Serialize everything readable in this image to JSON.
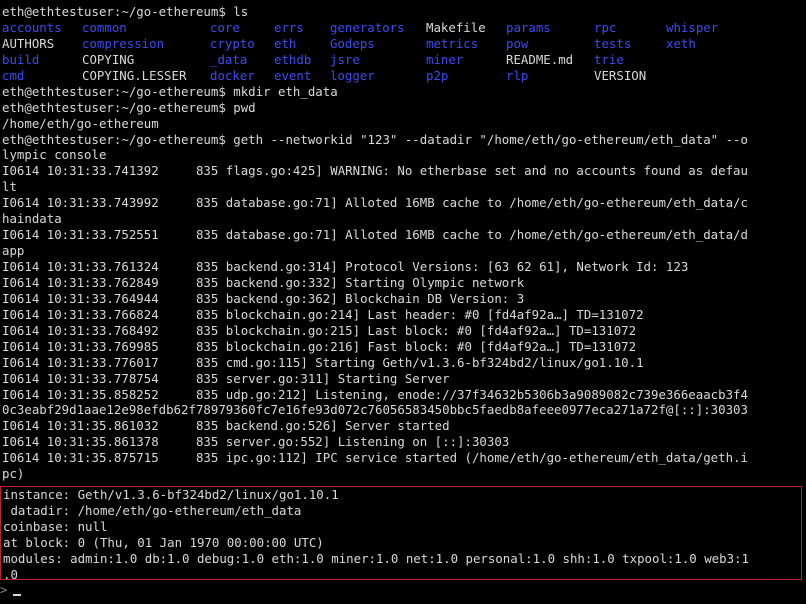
{
  "terminal": {
    "ls_command": "eth@ethtestuser:~/go-ethereum$ ls",
    "ls_rows": [
      [
        {
          "t": "accounts",
          "k": "dir"
        },
        {
          "t": "common",
          "k": "dir"
        },
        {
          "t": "core",
          "k": "dir"
        },
        {
          "t": "errs",
          "k": "dir"
        },
        {
          "t": "generators",
          "k": "dir"
        },
        {
          "t": "Makefile",
          "k": "file"
        },
        {
          "t": "params",
          "k": "dir"
        },
        {
          "t": "rpc",
          "k": "dir"
        },
        {
          "t": "whisper",
          "k": "dir"
        }
      ],
      [
        {
          "t": "AUTHORS",
          "k": "file"
        },
        {
          "t": "compression",
          "k": "dir"
        },
        {
          "t": "crypto",
          "k": "dir"
        },
        {
          "t": "eth",
          "k": "dir"
        },
        {
          "t": "Godeps",
          "k": "dir"
        },
        {
          "t": "metrics",
          "k": "dir"
        },
        {
          "t": "pow",
          "k": "dir"
        },
        {
          "t": "tests",
          "k": "dir"
        },
        {
          "t": "xeth",
          "k": "dir"
        }
      ],
      [
        {
          "t": "build",
          "k": "dir"
        },
        {
          "t": "COPYING",
          "k": "file"
        },
        {
          "t": "_data",
          "k": "dir"
        },
        {
          "t": "ethdb",
          "k": "dir"
        },
        {
          "t": "jsre",
          "k": "dir"
        },
        {
          "t": "miner",
          "k": "dir"
        },
        {
          "t": "README.md",
          "k": "file"
        },
        {
          "t": "trie",
          "k": "dir"
        },
        {
          "t": "",
          "k": "file"
        }
      ],
      [
        {
          "t": "cmd",
          "k": "dir"
        },
        {
          "t": "COPYING.LESSER",
          "k": "file"
        },
        {
          "t": "docker",
          "k": "dir"
        },
        {
          "t": "event",
          "k": "dir"
        },
        {
          "t": "logger",
          "k": "dir"
        },
        {
          "t": "p2p",
          "k": "dir"
        },
        {
          "t": "rlp",
          "k": "dir"
        },
        {
          "t": "VERSION",
          "k": "file"
        },
        {
          "t": "",
          "k": "file"
        }
      ]
    ],
    "lines": [
      "eth@ethtestuser:~/go-ethereum$ mkdir eth_data",
      "eth@ethtestuser:~/go-ethereum$ pwd",
      "/home/eth/go-ethereum",
      "eth@ethtestuser:~/go-ethereum$ geth --networkid \"123\" --datadir \"/home/eth/go-ethereum/eth_data\" --o",
      "lympic console",
      "I0614 10:31:33.741392     835 flags.go:425] WARNING: No etherbase set and no accounts found as defau",
      "lt",
      "I0614 10:31:33.743992     835 database.go:71] Alloted 16MB cache to /home/eth/go-ethereum/eth_data/c",
      "haindata",
      "I0614 10:31:33.752551     835 database.go:71] Alloted 16MB cache to /home/eth/go-ethereum/eth_data/d",
      "app",
      "I0614 10:31:33.761324     835 backend.go:314] Protocol Versions: [63 62 61], Network Id: 123",
      "I0614 10:31:33.762849     835 backend.go:332] Starting Olympic network",
      "I0614 10:31:33.764944     835 backend.go:362] Blockchain DB Version: 3",
      "I0614 10:31:33.766824     835 blockchain.go:214] Last header: #0 [fd4af92a…] TD=131072",
      "I0614 10:31:33.768492     835 blockchain.go:215] Last block: #0 [fd4af92a…] TD=131072",
      "I0614 10:31:33.769985     835 blockchain.go:216] Fast block: #0 [fd4af92a…] TD=131072",
      "I0614 10:31:33.776017     835 cmd.go:115] Starting Geth/v1.3.6-bf324bd2/linux/go1.10.1",
      "I0614 10:31:33.778754     835 server.go:311] Starting Server",
      "I0614 10:31:35.858252     835 udp.go:212] Listening, enode://37f34632b5306b3a9089082c739e366eaacb3f4",
      "0c3eabf29d1aae12e98efdb62f78979360fc7e16fe93d072c76056583450bbc5faedb8afeee0977eca271a72f@[::]:30303",
      "I0614 10:31:35.861032     835 backend.go:526] Server started",
      "I0614 10:31:35.861378     835 server.go:552] Listening on [::]:30303",
      "I0614 10:31:35.875715     835 ipc.go:112] IPC service started (/home/eth/go-ethereum/eth_data/geth.i",
      "pc)"
    ],
    "console_lines": [
      "instance: Geth/v1.3.6-bf324bd2/linux/go1.10.1",
      " datadir: /home/eth/go-ethereum/eth_data",
      "coinbase: null",
      "at block: 0 (Thu, 01 Jan 1970 00:00:00 UTC)",
      "modules: admin:1.0 db:1.0 debug:1.0 eth:1.0 miner:1.0 net:1.0 personal:1.0 shh:1.0 txpool:1.0 web3:1",
      ".0"
    ],
    "prompt_symbol": ">",
    "cursor_icon": "block-cursor-icon"
  },
  "colors": {
    "background": "#000000",
    "text": "#d9d9d9",
    "directory": "#3a4bf0",
    "highlight_border": "#c8202a"
  }
}
